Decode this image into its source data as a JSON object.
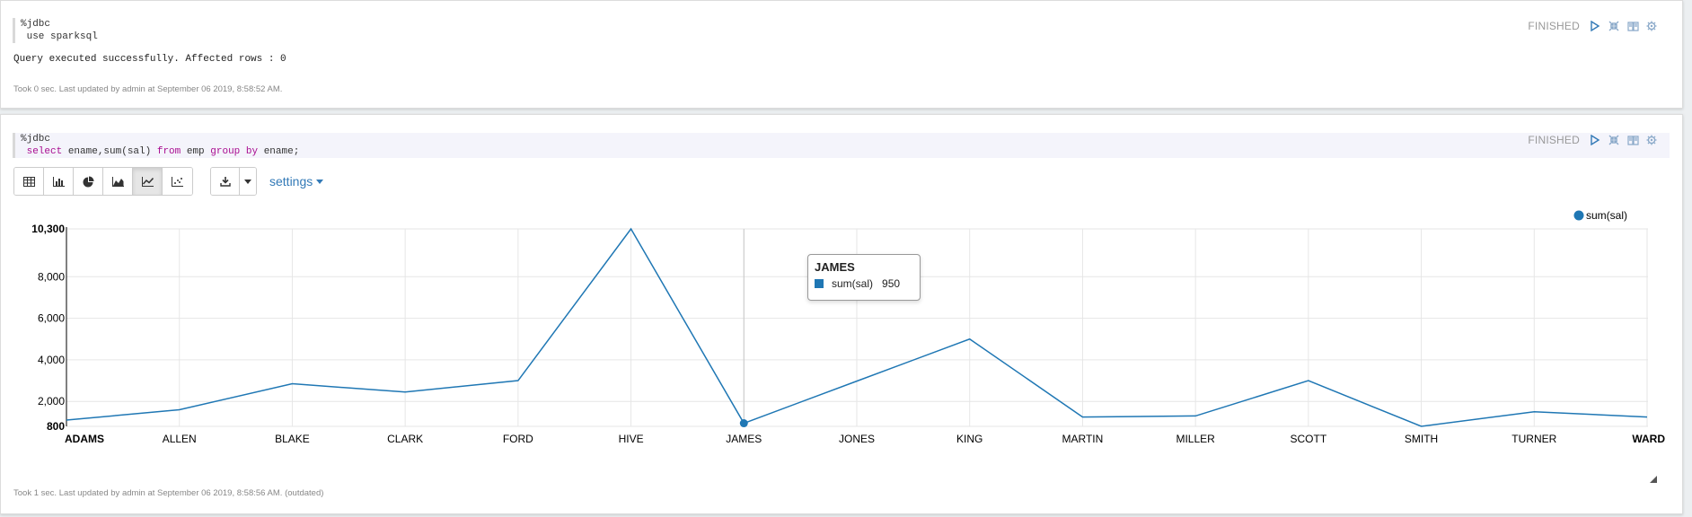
{
  "colors": {
    "series": "#1f77b4",
    "grid": "#e6e6e6",
    "finished": "#999999",
    "link": "#337ab7"
  },
  "paragraph1": {
    "code_lines": [
      "%jdbc",
      " use sparksql"
    ],
    "status": "FINISHED",
    "result": "Query executed successfully. Affected rows : 0",
    "footer": "Took 0 sec. Last updated by admin at September 06 2019, 8:58:52 AM.",
    "controls": [
      "run-icon",
      "hide-editor-icon",
      "book-icon",
      "gear-icon"
    ]
  },
  "paragraph2": {
    "code_line1": "%jdbc",
    "code_line2": {
      "t1": "select",
      "t2": " ename,sum(sal) ",
      "t3": "from",
      "t4": " emp ",
      "t5": "group",
      "t6": " ",
      "t7": "by",
      "t8": " ename;"
    },
    "status": "FINISHED",
    "controls": [
      "run-icon",
      "hide-editor-icon",
      "book-icon",
      "gear-icon"
    ],
    "toolbar": {
      "chart_buttons": [
        "table-icon",
        "bar-chart-icon",
        "pie-chart-icon",
        "area-chart-icon",
        "line-chart-icon",
        "scatter-chart-icon"
      ],
      "active": "line-chart-icon",
      "settings_label": "settings"
    },
    "footer": "Took 1 sec. Last updated by admin at September 06 2019, 8:58:56 AM. (outdated)"
  },
  "tooltip": {
    "title": "JAMES",
    "series": "sum(sal)",
    "value": "950"
  },
  "chart_data": {
    "type": "line",
    "categories": [
      "ADAMS",
      "ALLEN",
      "BLAKE",
      "CLARK",
      "FORD",
      "HIVE",
      "JAMES",
      "JONES",
      "KING",
      "MARTIN",
      "MILLER",
      "SCOTT",
      "SMITH",
      "TURNER",
      "WARD"
    ],
    "series": [
      {
        "name": "sum(sal)",
        "values": [
          1100,
          1600,
          2850,
          2450,
          3000,
          10300,
          950,
          2975,
          5000,
          1250,
          1300,
          3000,
          800,
          1500,
          1250
        ]
      }
    ],
    "ylim": [
      800,
      10300
    ],
    "yticks": [
      800,
      2000,
      4000,
      6000,
      8000,
      10300
    ],
    "ytick_labels": [
      "800",
      "2,000",
      "4,000",
      "6,000",
      "8,000",
      "10,300"
    ],
    "bold_ticks": [
      "800",
      "10,300",
      "ADAMS",
      "WARD"
    ],
    "legend": [
      "sum(sal)"
    ],
    "legend_position": "top-right",
    "grid": true,
    "highlighted": "JAMES",
    "xlabel": "",
    "ylabel": "",
    "title": ""
  }
}
